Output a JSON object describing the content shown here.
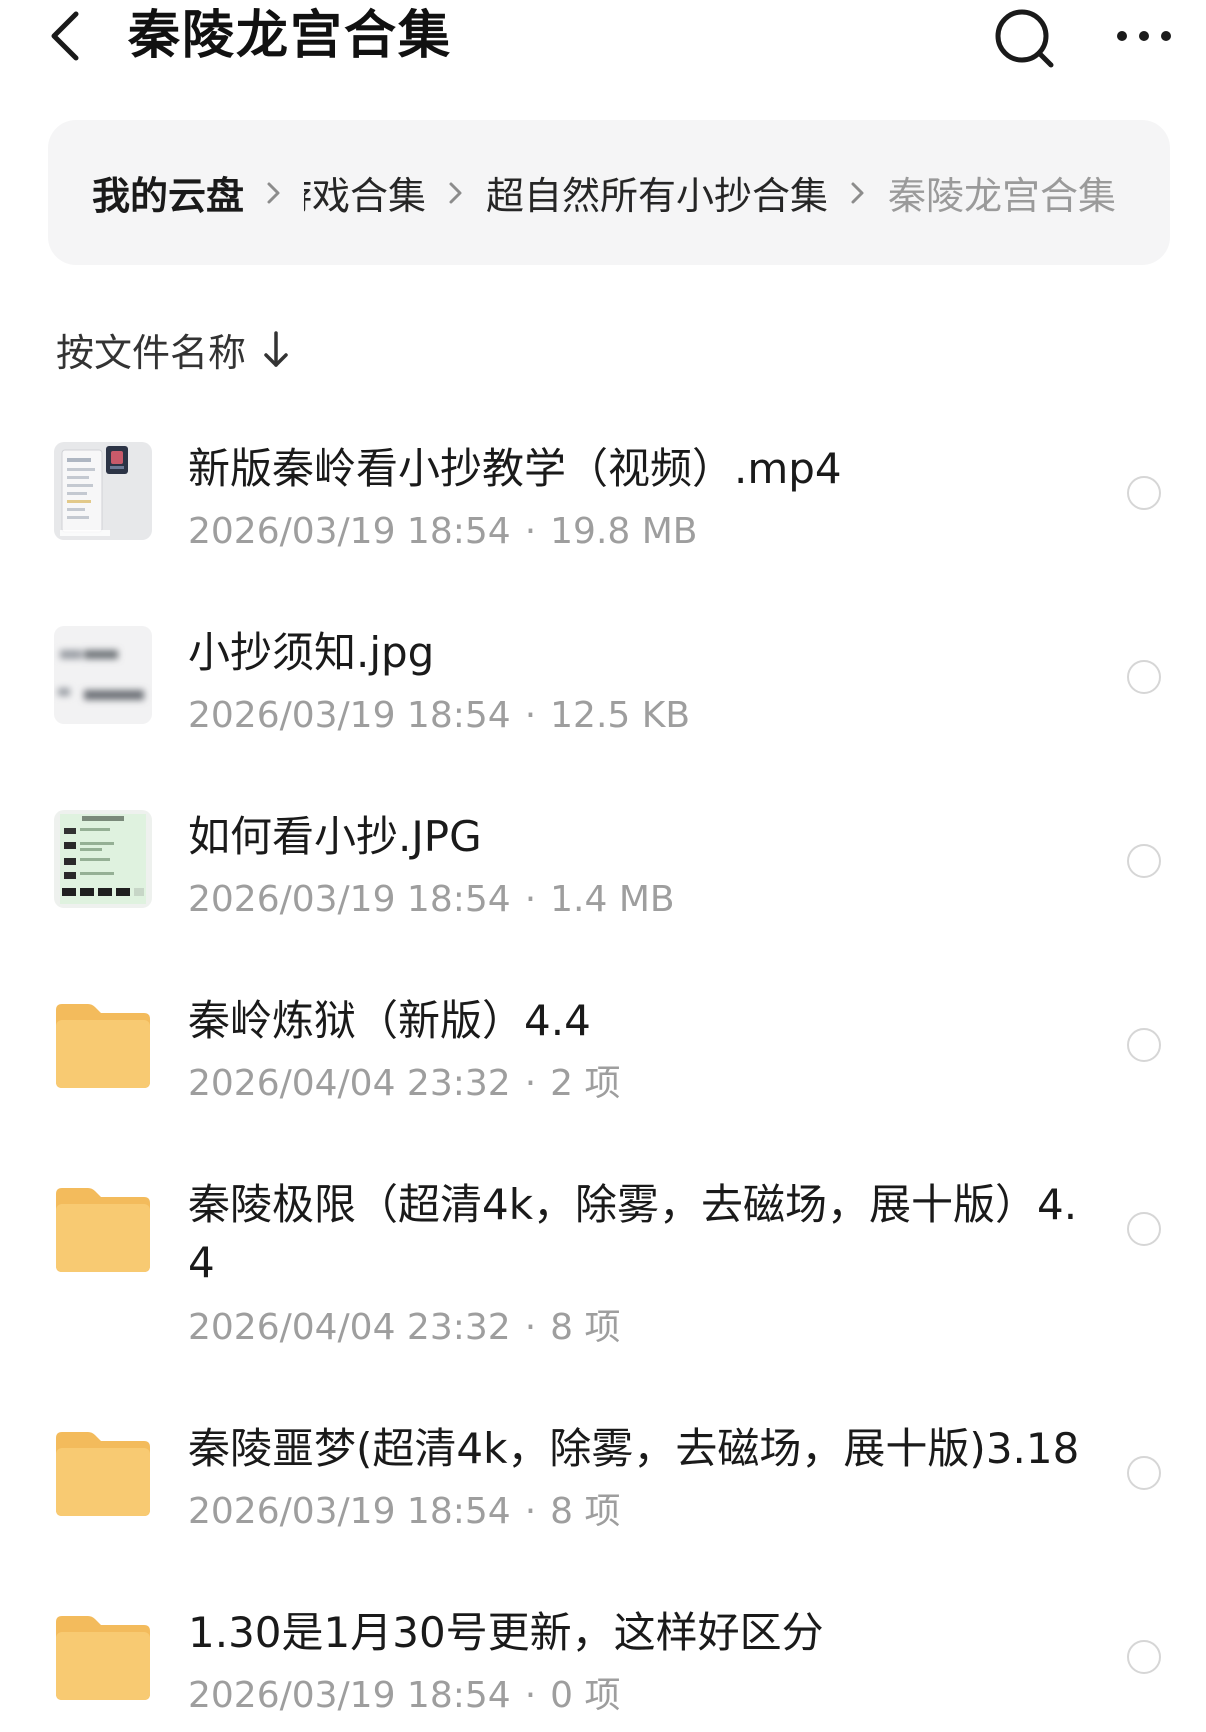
{
  "header": {
    "title": "秦陵龙宫合集",
    "back_icon": "chevron-left-icon",
    "search_icon": "search-icon",
    "more_icon": "more-horizontal-icon"
  },
  "breadcrumb": {
    "items": [
      "我的云盘",
      "游戏合集",
      "超自然所有小抄合集",
      "秦陵龙宫合集"
    ]
  },
  "sort": {
    "label": "按文件名称",
    "direction_icon": "arrow-down-icon"
  },
  "files": [
    {
      "kind": "video",
      "name": "新版秦岭看小抄教学（视频）.mp4",
      "date": "2026/03/19 18:54",
      "size": "19.8 MB"
    },
    {
      "kind": "image",
      "name": "小抄须知.jpg",
      "date": "2026/03/19 18:54",
      "size": "12.5 KB"
    },
    {
      "kind": "image",
      "name": "如何看小抄.JPG",
      "date": "2026/03/19 18:54",
      "size": "1.4 MB"
    },
    {
      "kind": "folder",
      "name": "秦岭炼狱（新版）4.4",
      "date": "2026/04/04 23:32",
      "size": "2 项"
    },
    {
      "kind": "folder",
      "name": "秦陵极限（超清4k，除雾，去磁场，展十版）4.4",
      "date": "2026/04/04 23:32",
      "size": "8 项"
    },
    {
      "kind": "folder",
      "name": "秦陵噩梦(超清4k，除雾，去磁场，展十版)3.18",
      "date": "2026/03/19 18:54",
      "size": "8 项"
    },
    {
      "kind": "folder",
      "name": "1.30是1月30号更新，这样好区分",
      "date": "2026/03/19 18:54",
      "size": "0 项"
    }
  ],
  "colors": {
    "folder": "#f6c56c",
    "meta_text": "#9e9e9e",
    "breadcrumb_bg": "#f5f5f6",
    "current_crumb": "#9a9a9a"
  }
}
